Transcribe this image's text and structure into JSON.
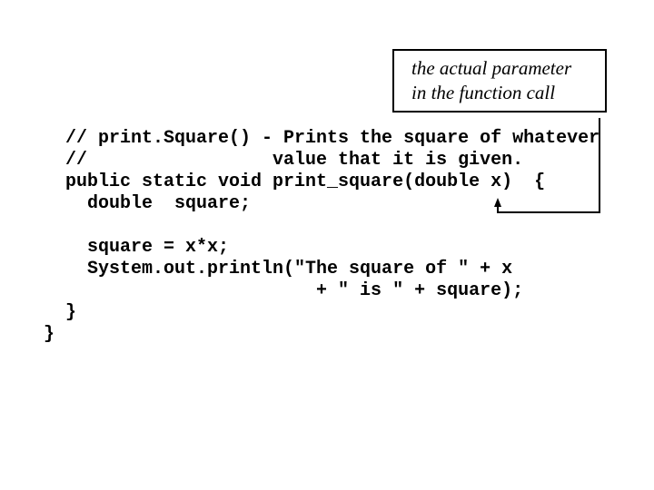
{
  "callout": {
    "lines": [
      "the actual parameter",
      "in the function call"
    ]
  },
  "code": {
    "lines": [
      "  // print.Square() - Prints the square of whatever",
      "  //                 value that it is given.",
      "  public static void print_square(double x)  {",
      "    double  square;",
      "",
      "    square = x*x;",
      "    System.out.println(\"The square of \" + x",
      "                         + \" is \" + square);",
      "  }",
      "}"
    ]
  },
  "annotation": {
    "arrow_target": "x",
    "connector": "arrow from callout to parameter x"
  }
}
